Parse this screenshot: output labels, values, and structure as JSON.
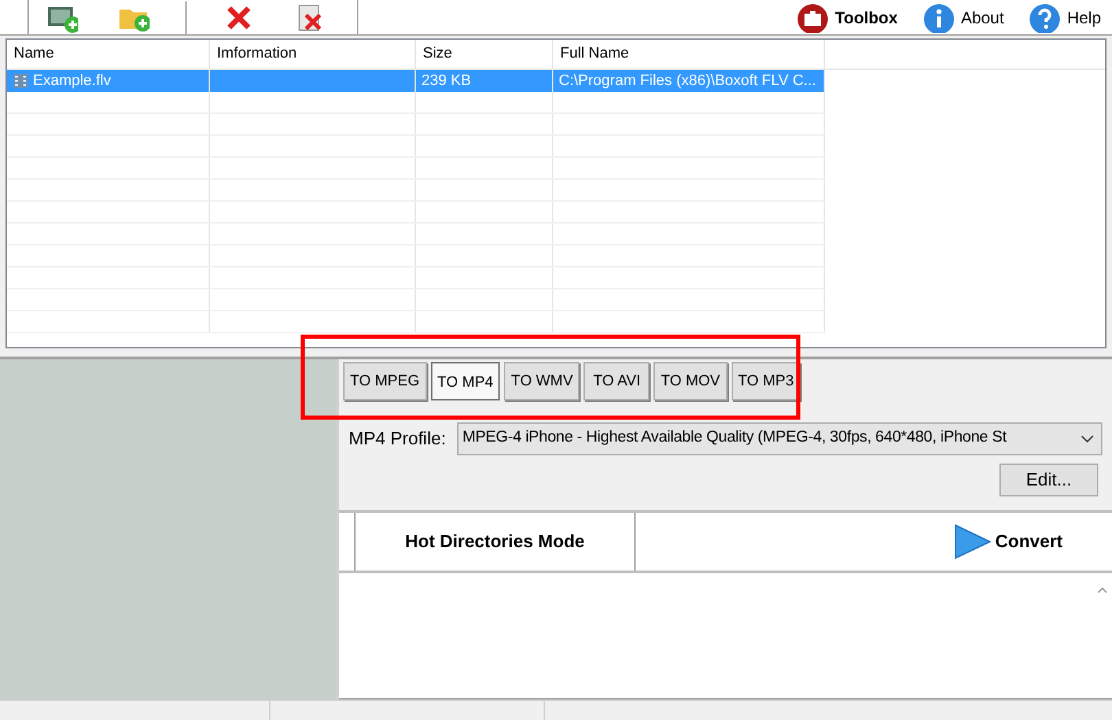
{
  "toolbar": {
    "left_buttons": [
      {
        "kind": "film-add"
      },
      {
        "kind": "folder-add"
      },
      {
        "kind": "remove"
      },
      {
        "kind": "clear"
      }
    ],
    "right_buttons": [
      {
        "kind": "toolbox",
        "label": "Toolbox"
      },
      {
        "kind": "about",
        "label": "About"
      },
      {
        "kind": "help",
        "label": "Help"
      }
    ]
  },
  "file_list": {
    "columns": [
      "Name",
      "Imformation",
      "Size",
      "Full Name"
    ],
    "rows": [
      {
        "name": "Example.flv",
        "information": "",
        "size": "239 KB",
        "full_name": "C:\\Program Files (x86)\\Boxoft FLV C...",
        "selected": true
      }
    ]
  },
  "format_tabs": [
    {
      "label": "TO MPEG",
      "selected": false
    },
    {
      "label": "TO MP4",
      "selected": true
    },
    {
      "label": "TO WMV",
      "selected": false
    },
    {
      "label": "TO AVI",
      "selected": false
    },
    {
      "label": "TO MOV",
      "selected": false
    },
    {
      "label": "TO MP3",
      "selected": false
    }
  ],
  "profile": {
    "label": "MP4 Profile:",
    "value": "MPEG-4 iPhone - Highest Available Quality (MPEG-4, 30fps, 640*480, iPhone St"
  },
  "edit_button": "Edit...",
  "hot_directories_button": "Hot Directories Mode",
  "convert_button": "Convert"
}
